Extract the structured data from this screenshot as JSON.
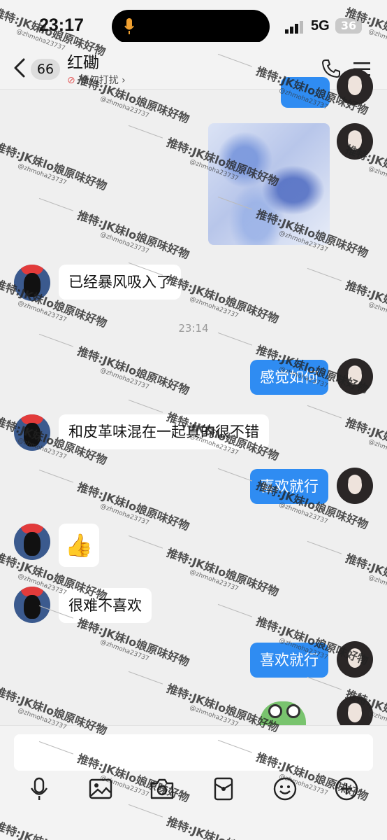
{
  "status_bar": {
    "time": "23:17",
    "network": "5G",
    "battery": "36"
  },
  "header": {
    "unread_count": "66",
    "chat_name": "红磡",
    "status": "请勿打扰"
  },
  "messages": [
    {
      "side": "out",
      "kind": "image"
    },
    {
      "side": "in",
      "text": "已经暴风吸入了"
    },
    {
      "kind": "time",
      "text": "23:14"
    },
    {
      "side": "out",
      "text": "感觉如何"
    },
    {
      "side": "in",
      "text": "和皮革味混在一起真的很不错"
    },
    {
      "side": "out",
      "text": "喜欢就行"
    },
    {
      "side": "in",
      "kind": "emoji",
      "text": "👍"
    },
    {
      "side": "in",
      "text": "很难不喜欢"
    },
    {
      "side": "out",
      "text": "喜欢就行"
    },
    {
      "side": "out",
      "kind": "sticker"
    }
  ],
  "composer": {
    "placeholder": ""
  },
  "toolbar": {
    "icons": [
      "mic-icon",
      "image-icon",
      "camera-icon",
      "red-packet-icon",
      "emoji-icon",
      "plus-icon"
    ]
  },
  "watermark": {
    "text": "推特:JK妹lo娘原味好物",
    "handle": "@zhmoha23737"
  },
  "colors": {
    "outgoing_bubble": "#2f8cf2",
    "incoming_bubble": "#ffffff",
    "background": "#efefef"
  }
}
